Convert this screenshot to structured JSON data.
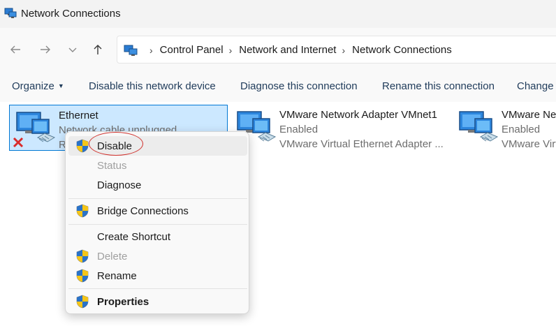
{
  "window": {
    "title": "Network Connections",
    "icon": "network-connections-icon"
  },
  "nav": {
    "back_icon": "arrow-left-icon",
    "forward_icon": "arrow-right-icon",
    "recent_icon": "chevron-down-icon",
    "up_icon": "arrow-up-icon"
  },
  "breadcrumb": [
    "Control Panel",
    "Network and Internet",
    "Network Connections"
  ],
  "toolbar": {
    "organize": "Organize",
    "disable": "Disable this network device",
    "diagnose": "Diagnose this connection",
    "rename": "Rename this connection",
    "change": "Change"
  },
  "adapters": [
    {
      "name": "Ethernet",
      "status": "Network cable unplugged",
      "device": "R",
      "selected": true,
      "disconnected": true
    },
    {
      "name": "VMware Network Adapter VMnet1",
      "status": "Enabled",
      "device": "VMware Virtual Ethernet Adapter ..."
    },
    {
      "name": "VMware Ne",
      "status": "Enabled",
      "device": "VMware Virtu"
    }
  ],
  "context_menu": {
    "disable": "Disable",
    "status": "Status",
    "diagnose": "Diagnose",
    "bridge": "Bridge Connections",
    "shortcut": "Create Shortcut",
    "delete": "Delete",
    "rename": "Rename",
    "properties": "Properties"
  },
  "colors": {
    "accent": "#0078d4",
    "selection": "#cce8ff",
    "highlight_circle": "#d0312d"
  }
}
